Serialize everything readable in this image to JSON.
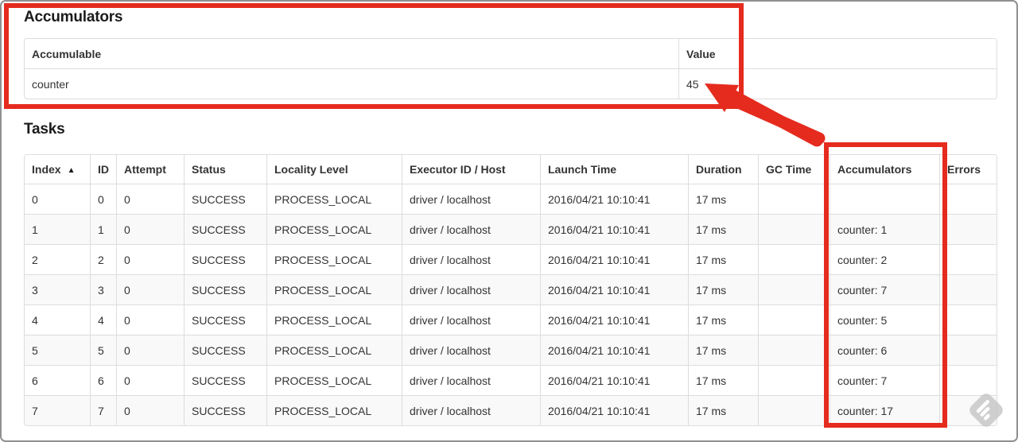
{
  "accumulators_section": {
    "title": "Accumulators",
    "table": {
      "col_headers": {
        "accumulable": "Accumulable",
        "value": "Value"
      },
      "rows": [
        {
          "accumulable": "counter",
          "value": "45"
        }
      ]
    }
  },
  "tasks_section": {
    "title": "Tasks",
    "table": {
      "col_headers": {
        "index": "Index",
        "id": "ID",
        "attempt": "Attempt",
        "status": "Status",
        "locality": "Locality Level",
        "executor": "Executor ID / Host",
        "launch": "Launch Time",
        "duration": "Duration",
        "gc": "GC Time",
        "accumulators": "Accumulators",
        "errors": "Errors"
      },
      "sort_icon": "▲",
      "rows": [
        {
          "index": "0",
          "id": "0",
          "attempt": "0",
          "status": "SUCCESS",
          "locality": "PROCESS_LOCAL",
          "executor": "driver / localhost",
          "launch": "2016/04/21 10:10:41",
          "duration": "17 ms",
          "gc": "",
          "accumulators": "",
          "errors": ""
        },
        {
          "index": "1",
          "id": "1",
          "attempt": "0",
          "status": "SUCCESS",
          "locality": "PROCESS_LOCAL",
          "executor": "driver / localhost",
          "launch": "2016/04/21 10:10:41",
          "duration": "17 ms",
          "gc": "",
          "accumulators": "counter: 1",
          "errors": ""
        },
        {
          "index": "2",
          "id": "2",
          "attempt": "0",
          "status": "SUCCESS",
          "locality": "PROCESS_LOCAL",
          "executor": "driver / localhost",
          "launch": "2016/04/21 10:10:41",
          "duration": "17 ms",
          "gc": "",
          "accumulators": "counter: 2",
          "errors": ""
        },
        {
          "index": "3",
          "id": "3",
          "attempt": "0",
          "status": "SUCCESS",
          "locality": "PROCESS_LOCAL",
          "executor": "driver / localhost",
          "launch": "2016/04/21 10:10:41",
          "duration": "17 ms",
          "gc": "",
          "accumulators": "counter: 7",
          "errors": ""
        },
        {
          "index": "4",
          "id": "4",
          "attempt": "0",
          "status": "SUCCESS",
          "locality": "PROCESS_LOCAL",
          "executor": "driver / localhost",
          "launch": "2016/04/21 10:10:41",
          "duration": "17 ms",
          "gc": "",
          "accumulators": "counter: 5",
          "errors": ""
        },
        {
          "index": "5",
          "id": "5",
          "attempt": "0",
          "status": "SUCCESS",
          "locality": "PROCESS_LOCAL",
          "executor": "driver / localhost",
          "launch": "2016/04/21 10:10:41",
          "duration": "17 ms",
          "gc": "",
          "accumulators": "counter: 6",
          "errors": ""
        },
        {
          "index": "6",
          "id": "6",
          "attempt": "0",
          "status": "SUCCESS",
          "locality": "PROCESS_LOCAL",
          "executor": "driver / localhost",
          "launch": "2016/04/21 10:10:41",
          "duration": "17 ms",
          "gc": "",
          "accumulators": "counter: 7",
          "errors": ""
        },
        {
          "index": "7",
          "id": "7",
          "attempt": "0",
          "status": "SUCCESS",
          "locality": "PROCESS_LOCAL",
          "executor": "driver / localhost",
          "launch": "2016/04/21 10:10:41",
          "duration": "17 ms",
          "gc": "",
          "accumulators": "counter: 17",
          "errors": ""
        }
      ]
    }
  },
  "annotations": {
    "highlight_color": "#e52b1e"
  },
  "colors": {
    "row_stripe": "#f9f9f9",
    "table_border": "#dddddd",
    "text": "#333333",
    "watermark_gray": "#c8c8c8"
  }
}
